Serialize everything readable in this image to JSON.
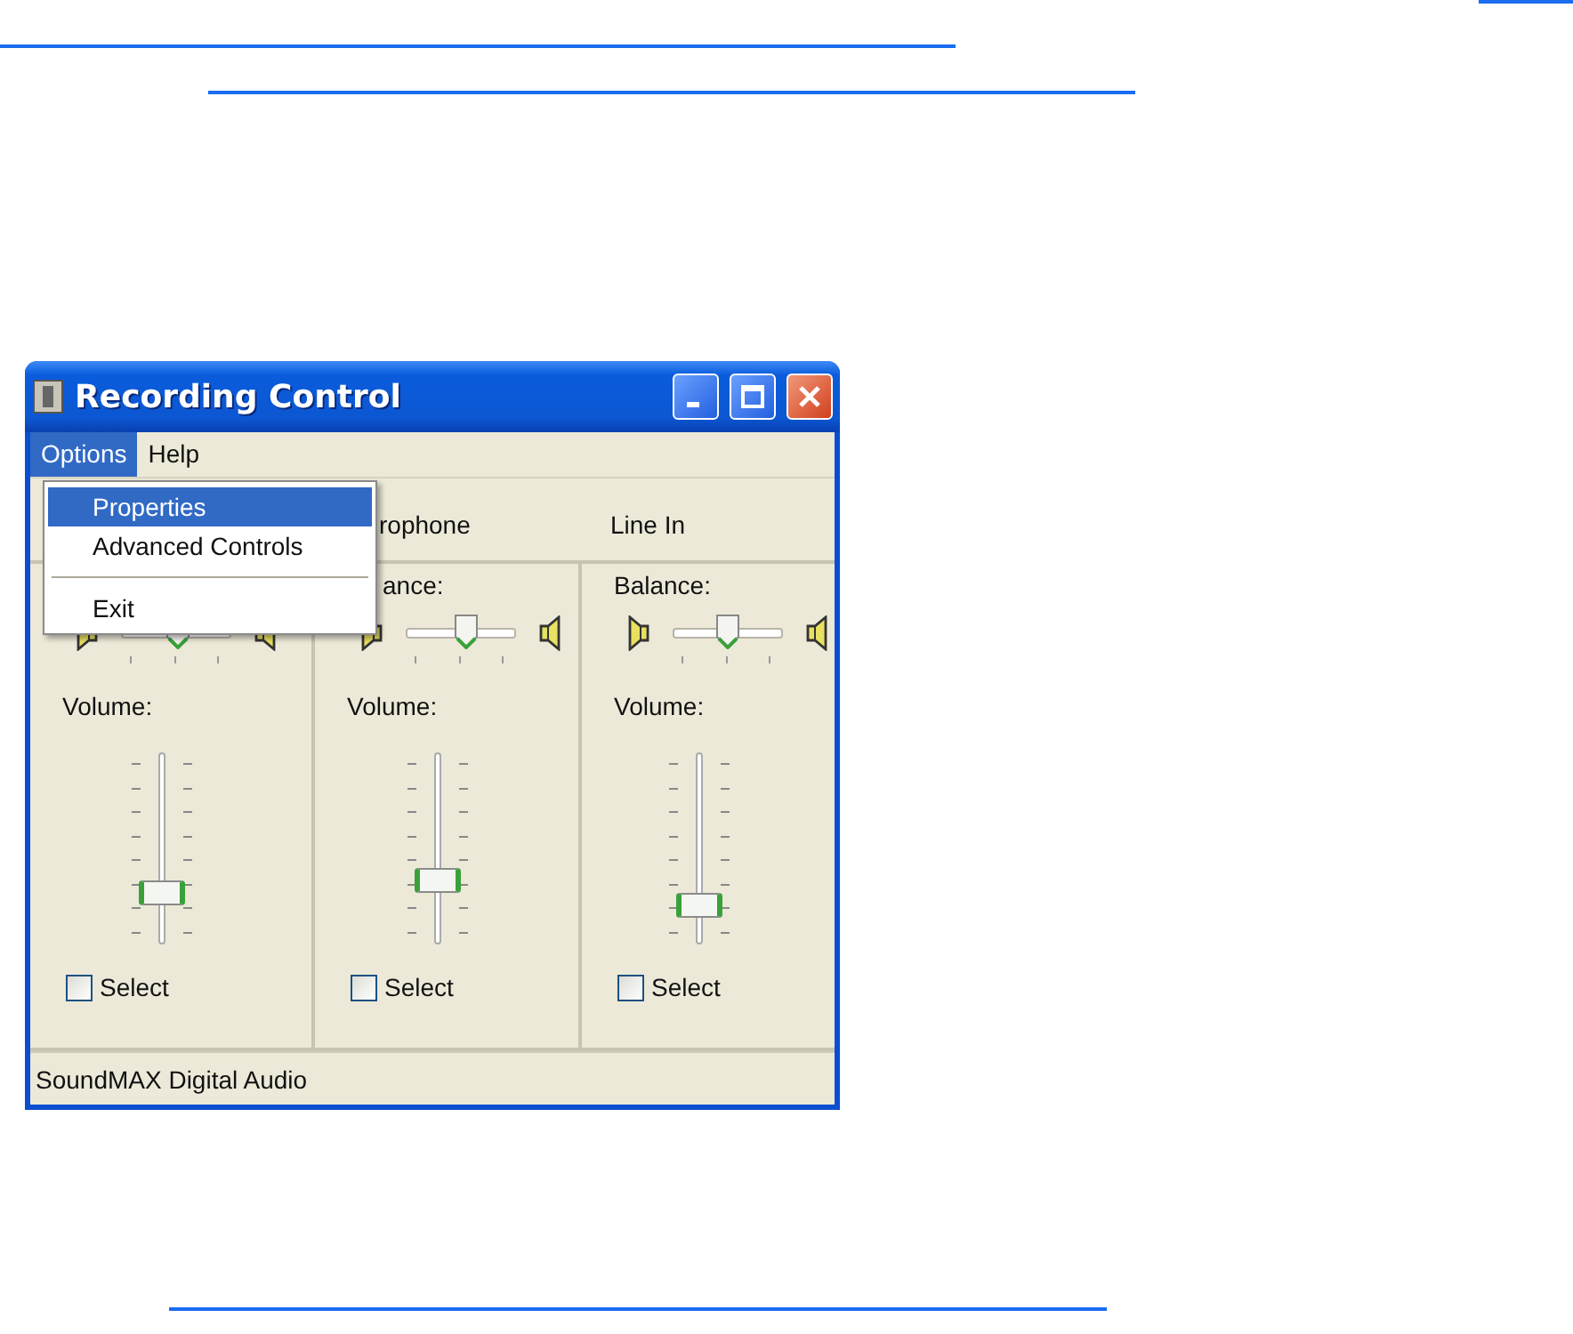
{
  "window": {
    "title": "Recording Control"
  },
  "menu_bar": [
    {
      "label": "Options",
      "selected": true
    },
    {
      "label": "Help",
      "selected": false
    }
  ],
  "dropdown": [
    {
      "kind": "item",
      "label": "Properties",
      "selected": true
    },
    {
      "kind": "item",
      "label": "Advanced Controls",
      "selected": false
    },
    {
      "kind": "separator"
    },
    {
      "kind": "item",
      "label": "Exit",
      "selected": false
    }
  ],
  "channels": [
    {
      "balance": {
        "level": 0.52
      },
      "volume": {
        "label": "Volume:",
        "level": 0.23
      },
      "select_label": "Select",
      "checked": false
    },
    {
      "name": "rophone",
      "balance_label": "ance:",
      "balance": {
        "level": 0.55
      },
      "volume": {
        "label": "Volume:",
        "level": 0.31
      },
      "select_label": "Select",
      "checked": false
    },
    {
      "name": "Line In",
      "balance_label": "Balance:",
      "balance": {
        "level": 0.5
      },
      "volume": {
        "label": "Volume:",
        "level": 0.16
      },
      "select_label": "Select",
      "checked": false
    }
  ],
  "status_bar": "SoundMAX Digital Audio"
}
